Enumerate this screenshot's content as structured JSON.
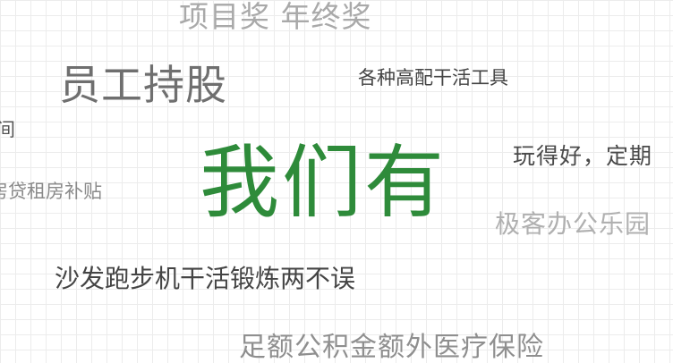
{
  "phrases": {
    "project_bonus": "项目奖 年终奖",
    "employee_stock": "员工持股",
    "tools": "各种高配干活工具",
    "edge_left_1": "间",
    "headline": "我们有",
    "play_well": "玩得好，定期",
    "housing_loan": "房贷租房补贴",
    "geek_park": "极客办公乐园",
    "treadmill": "沙发跑步机干活锻炼两不误",
    "insurance": "足额公积金额外医疗保险"
  },
  "colors": {
    "headline": "#2e8b3a",
    "grid_line": "#ececec",
    "background": "#ffffff"
  }
}
